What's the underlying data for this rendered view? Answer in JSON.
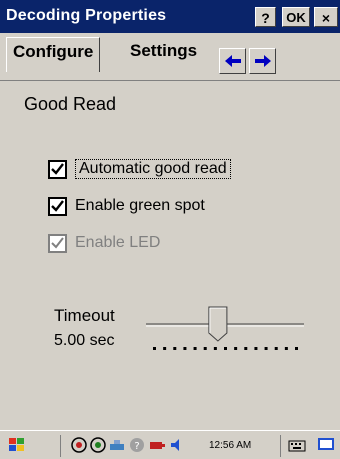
{
  "window": {
    "title": "Decoding Properties",
    "help_button": "?",
    "ok_button": "OK",
    "close_button": "×"
  },
  "tabs": [
    {
      "label": "Configure"
    },
    {
      "label": "Settings"
    }
  ],
  "section": {
    "title": "Good Read"
  },
  "options": [
    {
      "label": "Automatic good read",
      "checked": true,
      "enabled": true
    },
    {
      "label": "Enable green spot",
      "checked": true,
      "enabled": true
    },
    {
      "label": "Enable LED",
      "checked": true,
      "enabled": false
    }
  ],
  "timeout": {
    "label": "Timeout",
    "value": "5.00 sec",
    "position": 0.45
  },
  "taskbar": {
    "clock": "12:56 AM"
  },
  "colors": {
    "titlebar": "#0a246a",
    "window_bg": "#d4d0c8"
  }
}
